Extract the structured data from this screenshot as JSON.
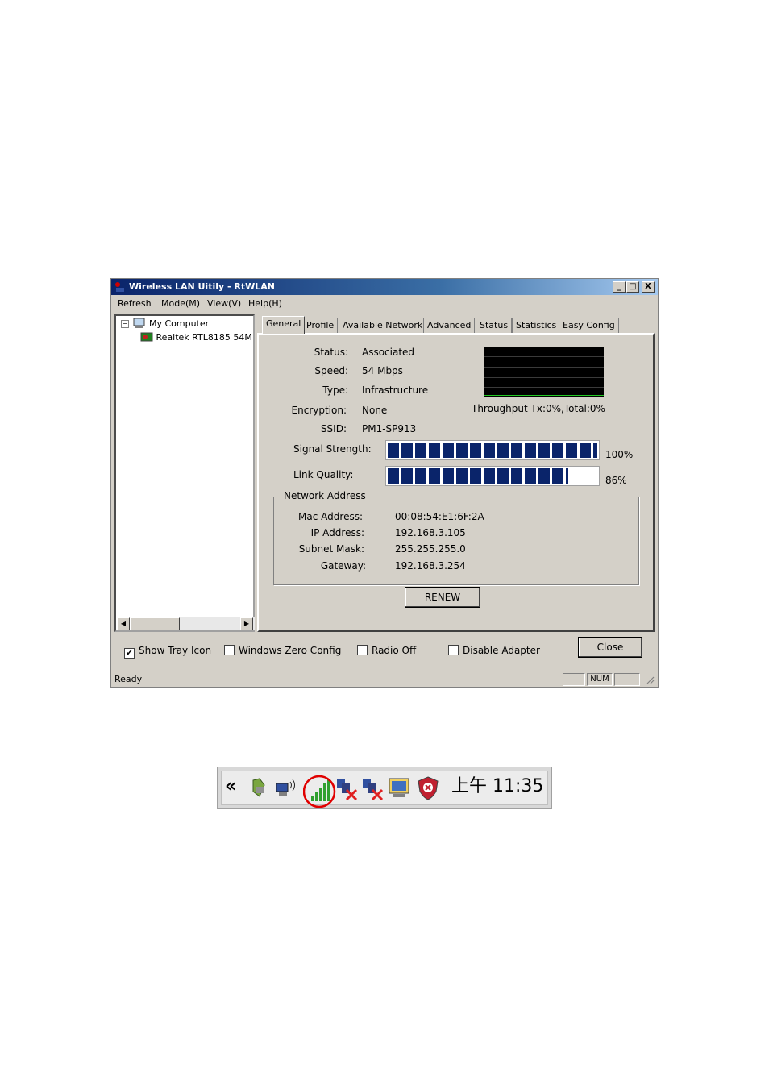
{
  "window": {
    "title": "Wireless LAN Uitily - RtWLAN",
    "controls": [
      "_",
      "□",
      "X"
    ],
    "menu": [
      "Refresh",
      "Mode(M)",
      "View(V)",
      "Help(H)"
    ]
  },
  "tree": {
    "root": "My Computer",
    "child": "Realtek RTL8185 54M"
  },
  "tabs": [
    "General",
    "Profile",
    "Available Network",
    "Advanced",
    "Status",
    "Statistics",
    "Easy Config"
  ],
  "general": {
    "status_label": "Status:",
    "status_value": "Associated",
    "speed_label": "Speed:",
    "speed_value": "54 Mbps",
    "type_label": "Type:",
    "type_value": "Infrastructure",
    "encryption_label": "Encryption:",
    "encryption_value": "None",
    "ssid_label": "SSID:",
    "ssid_value": "PM1-SP913",
    "throughput_label": "Throughput",
    "throughput_value": "Tx:0%,Total:0%",
    "signal_label": "Signal Strength:",
    "signal_text": "100%",
    "signal_level": 1.0,
    "link_label": "Link Quality:",
    "link_text": "86%",
    "link_level": 0.86
  },
  "network_address": {
    "title": "Network Address",
    "mac_label": "Mac Address:",
    "mac_value": "00:08:54:E1:6F:2A",
    "ip_label": "IP Address:",
    "ip_value": "192.168.3.105",
    "subnet_label": "Subnet Mask:",
    "subnet_value": "255.255.255.0",
    "gateway_label": "Gateway:",
    "gateway_value": "192.168.3.254"
  },
  "renew_button": "RENEW",
  "options": {
    "show_tray_icon": "Show Tray Icon",
    "windows_zero_config": "Windows Zero Config",
    "radio_off": "Radio Off",
    "disable_adapter": "Disable Adapter"
  },
  "close_button": "Close",
  "statusbar": {
    "text": "Ready",
    "num": "NUM"
  },
  "tray": {
    "expand": "«",
    "clock": "上午 11:35",
    "icons": [
      "safely-remove-icon",
      "wireless-network-icon",
      "signal-strength-icon",
      "network-disconnected-icon",
      "network-disconnected-icon",
      "display-icon",
      "security-shield-icon"
    ],
    "highlight_color": "#e00000"
  }
}
